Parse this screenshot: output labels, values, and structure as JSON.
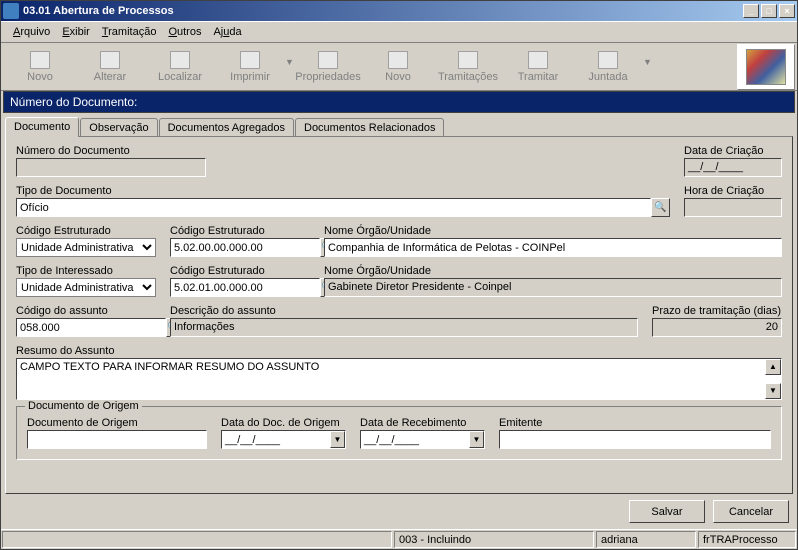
{
  "window": {
    "title": "03.01 Abertura de Processos"
  },
  "menu": {
    "arquivo": "Arquivo",
    "exibir": "Exibir",
    "tramitacao": "Tramitação",
    "outros": "Outros",
    "ajuda": "Ajuda"
  },
  "toolbar": {
    "novo": "Novo",
    "alterar": "Alterar",
    "localizar": "Localizar",
    "imprimir": "Imprimir",
    "propriedades": "Propriedades",
    "novo2": "Novo",
    "tramitacoes": "Tramitações",
    "tramitar": "Tramitar",
    "juntada": "Juntada"
  },
  "doc_header": "Número do Documento:",
  "tabs": {
    "documento": "Documento",
    "observacao": "Observação",
    "agregados": "Documentos Agregados",
    "relacionados": "Documentos Relacionados"
  },
  "labels": {
    "numero_doc": "Número do Documento",
    "data_criacao": "Data de Criação",
    "hora_criacao": "Hora de Criação",
    "tipo_doc": "Tipo de Documento",
    "cod_estrut": "Código Estruturado",
    "nome_orgao": "Nome Órgão/Unidade",
    "tipo_interessado": "Tipo de Interessado",
    "cod_assunto": "Código do assunto",
    "desc_assunto": "Descrição do assunto",
    "prazo": "Prazo de tramitação (dias)",
    "resumo": "Resumo do Assunto",
    "doc_origem_legend": "Documento de Origem",
    "doc_origem": "Documento de Origem",
    "data_doc_origem": "Data do Doc. de Origem",
    "data_recebimento": "Data de Recebimento",
    "emitente": "Emitente"
  },
  "values": {
    "numero_doc": "",
    "data_criacao": "__/__/____",
    "hora_criacao": "",
    "tipo_doc": "Ofício",
    "cod_estrut_sel": "Unidade Administrativa",
    "cod_estrut1": "5.02.00.00.000.00",
    "nome_orgao1": "Companhia de Informática de Pelotas - COINPel",
    "tipo_interessado_sel": "Unidade Administrativa",
    "cod_estrut2": "5.02.01.00.000.00",
    "nome_orgao2": "Gabinete Diretor Presidente - Coinpel",
    "cod_assunto": "058.000",
    "desc_assunto": "Informações",
    "prazo": "20",
    "resumo": "CAMPO TEXTO PARA INFORMAR RESUMO DO ASSUNTO",
    "doc_origem": "",
    "data_doc_origem": "__/__/____",
    "data_recebimento": "__/__/____",
    "emitente": ""
  },
  "buttons": {
    "salvar": "Salvar",
    "cancelar": "Cancelar"
  },
  "status": {
    "mode": "003 - Incluindo",
    "user": "adriana",
    "form": "frTRAProcesso"
  }
}
